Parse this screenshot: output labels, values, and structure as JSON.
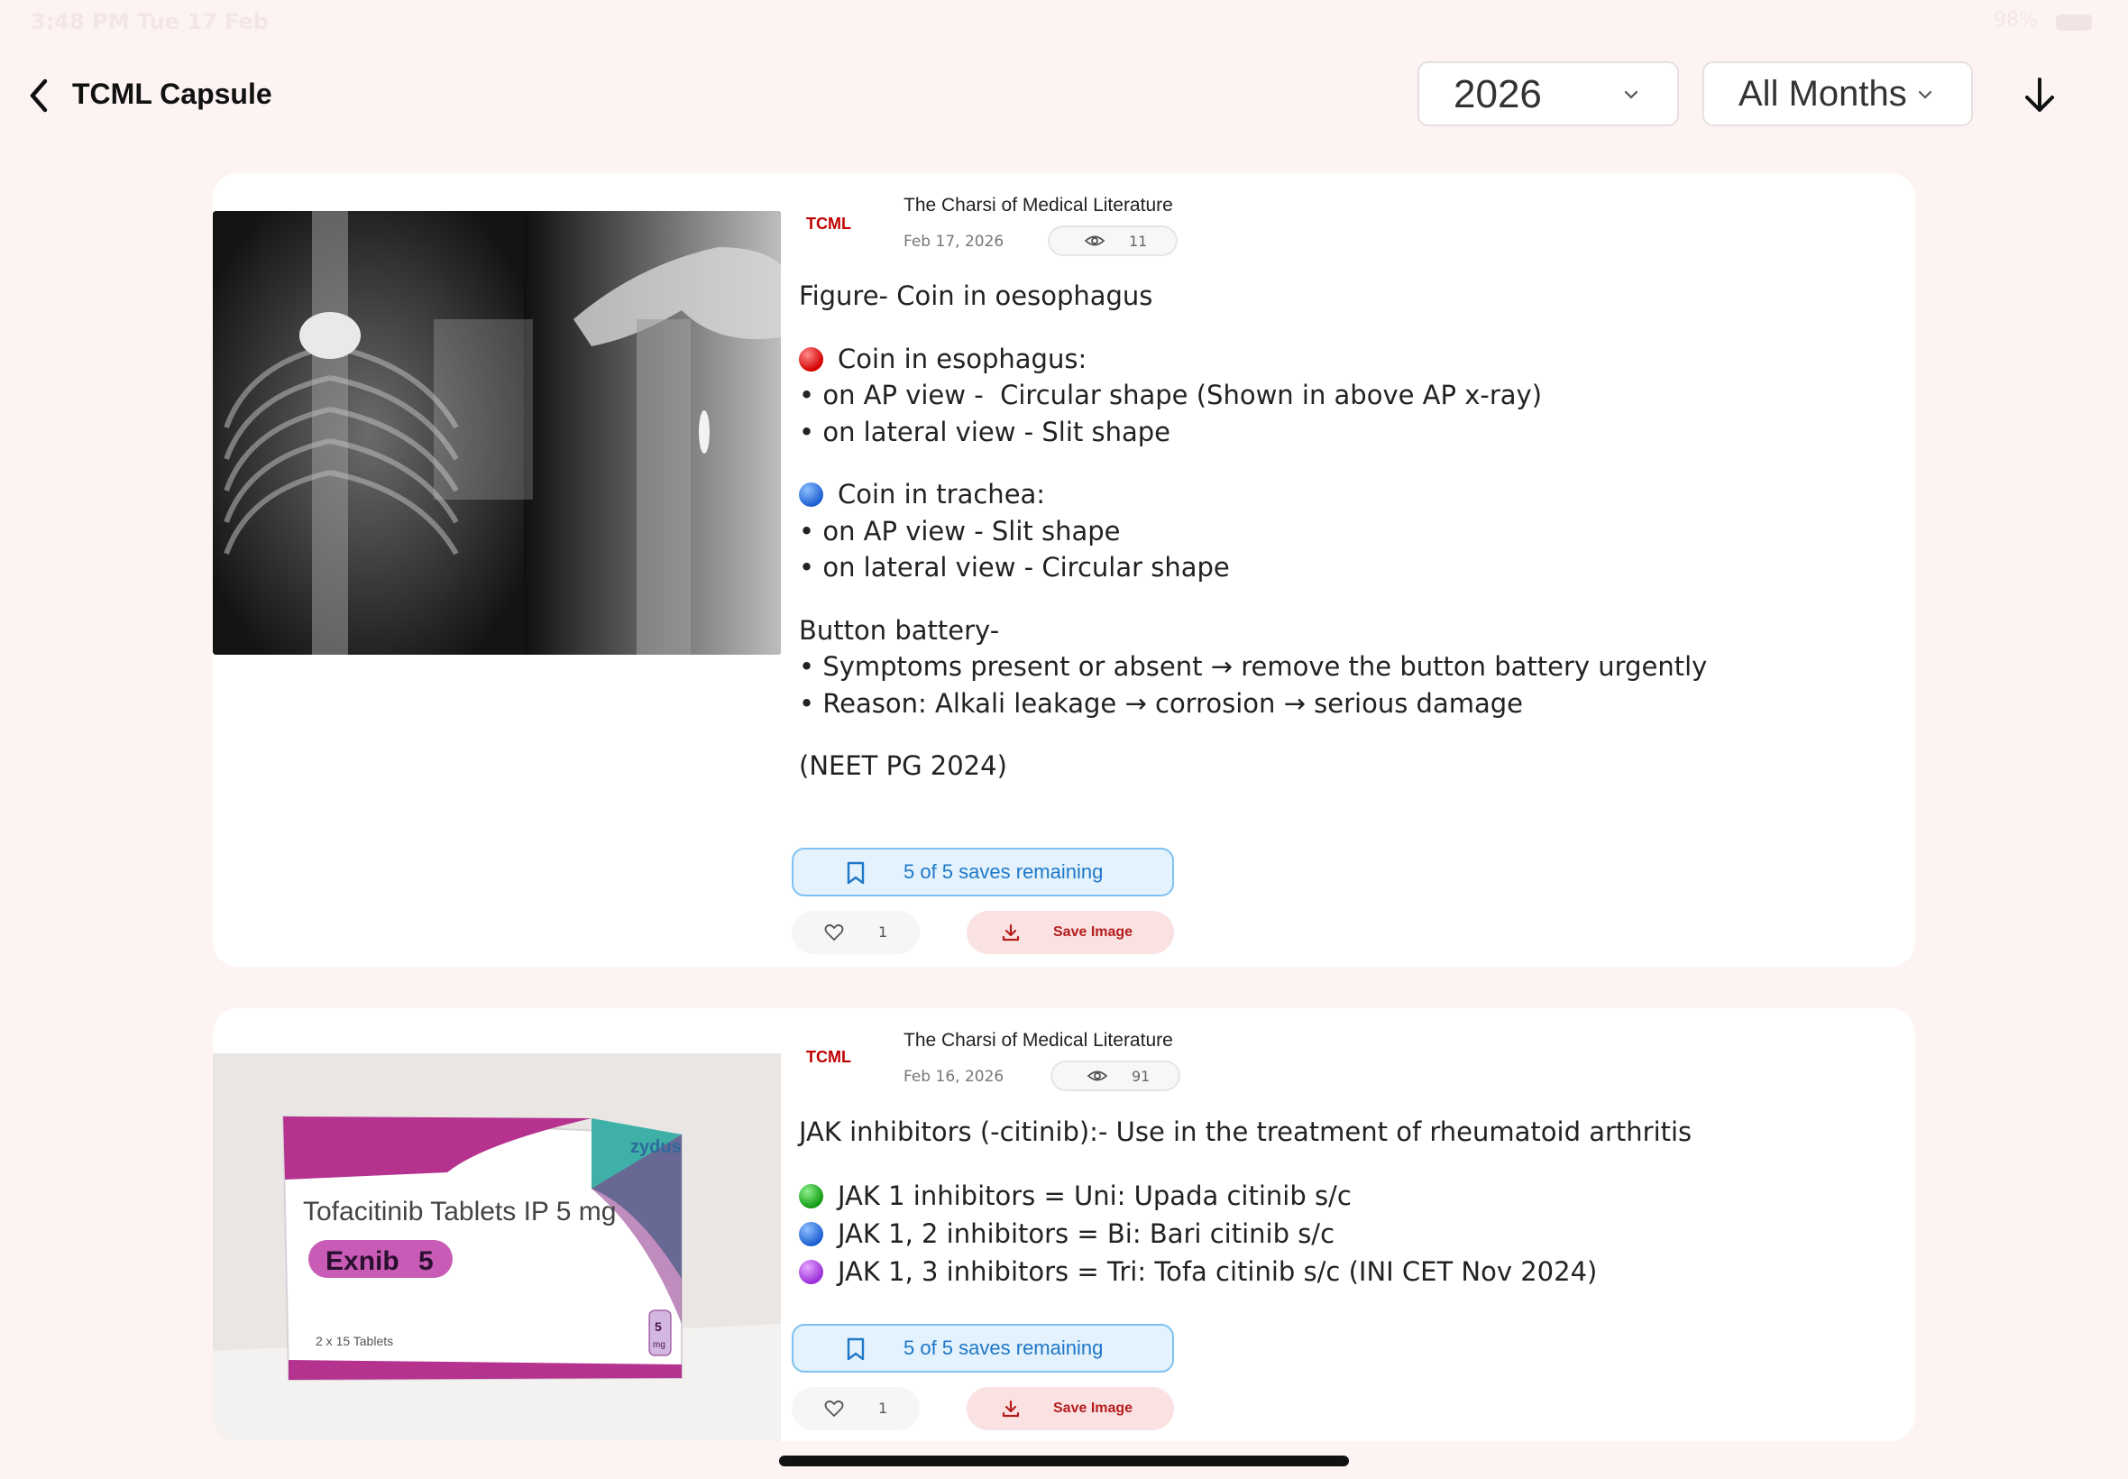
{
  "status_bar": {
    "time": "3:48 PM   Tue 17 Feb",
    "battery": "98%"
  },
  "header": {
    "title": "TCML Capsule",
    "year_select": {
      "selected": "2026"
    },
    "month_select": {
      "selected": "All Months"
    }
  },
  "posts": [
    {
      "author_logo": "TCML",
      "author": "The Charsi of Medical Literature",
      "date": "Feb 17, 2026",
      "views": "11",
      "lines": [
        {
          "dot": "",
          "text": "Figure- Coin in oesophagus"
        },
        {
          "dot": "",
          "text": ""
        },
        {
          "dot": "red",
          "text": "Coin in esophagus:"
        },
        {
          "dot": "",
          "text": "• on AP view -  Circular shape (Shown in above AP x-ray)"
        },
        {
          "dot": "",
          "text": "• on lateral view - Slit shape"
        },
        {
          "dot": "",
          "text": ""
        },
        {
          "dot": "blue",
          "text": "Coin in trachea:"
        },
        {
          "dot": "",
          "text": "• on AP view - Slit shape"
        },
        {
          "dot": "",
          "text": "• on lateral view - Circular shape"
        },
        {
          "dot": "",
          "text": ""
        },
        {
          "dot": "",
          "text": "Button battery-"
        },
        {
          "dot": "",
          "text": "• Symptoms present or absent → remove the button battery urgently"
        },
        {
          "dot": "",
          "text": "• Reason: Alkali leakage → corrosion → serious damage"
        },
        {
          "dot": "",
          "text": ""
        },
        {
          "dot": "",
          "text": "(NEET PG 2024)"
        }
      ],
      "saves_label": "5 of 5 saves remaining",
      "likes": "1",
      "save_image_label": "Save Image"
    },
    {
      "author_logo": "TCML",
      "author": "The Charsi of Medical Literature",
      "date": "Feb 16, 2026",
      "views": "91",
      "lines": [
        {
          "dot": "",
          "text": "JAK inhibitors (-citinib):- Use in the treatment of rheumatoid arthritis"
        },
        {
          "dot": "",
          "text": ""
        },
        {
          "dot": "green",
          "text": "JAK 1 inhibitors = Uni: Upada citinib s/c"
        },
        {
          "dot": "blue",
          "text": "JAK 1, 2 inhibitors = Bi: Bari citinib s/c"
        },
        {
          "dot": "purple",
          "text": "JAK 1, 3 inhibitors = Tri: Tofa citinib s/c (INI CET Nov 2024)"
        }
      ],
      "saves_label": "5 of 5 saves remaining",
      "likes": "1",
      "save_image_label": "Save Image",
      "image_text": {
        "brand": "zydus",
        "product": "Tofacitinib Tablets IP 5 mg",
        "name": "Exnib",
        "strength": "5",
        "pack": "2 x 15 Tablets",
        "badge_num": "5",
        "badge_unit": "mg"
      }
    }
  ]
}
